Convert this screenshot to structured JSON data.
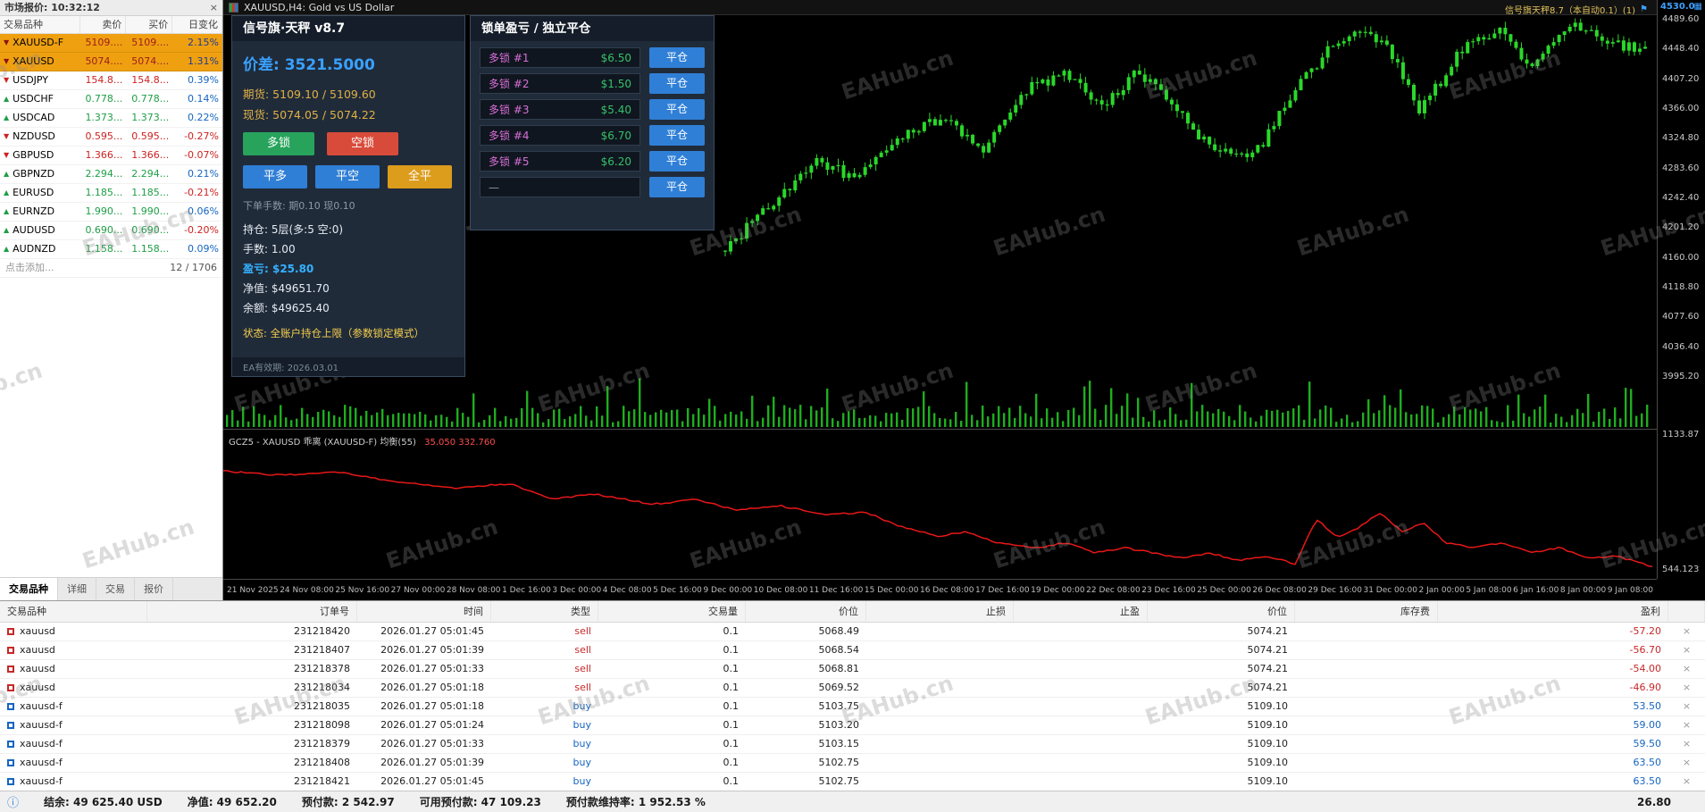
{
  "market_watch": {
    "title": "市场报价: 10:32:12",
    "close_glyph": "×",
    "columns": [
      "交易品种",
      "卖价",
      "买价",
      "日变化"
    ],
    "rows": [
      {
        "sym": "XAUUSD-F",
        "bid": "5109....",
        "ask": "5109....",
        "chg": "2.15%",
        "tick": "down",
        "price_color": "#9b1c1c",
        "chg_color": "#1f3a93",
        "hl": true
      },
      {
        "sym": "XAUUSD",
        "bid": "5074....",
        "ask": "5074....",
        "chg": "1.31%",
        "tick": "down",
        "price_color": "#9b1c1c",
        "chg_color": "#1f3a93",
        "hl": true
      },
      {
        "sym": "USDJPY",
        "bid": "154.8...",
        "ask": "154.8...",
        "chg": "0.39%",
        "tick": "down",
        "price_color": "#cc2222",
        "chg_color": "#1565c0",
        "hl": false
      },
      {
        "sym": "USDCHF",
        "bid": "0.778...",
        "ask": "0.778...",
        "chg": "0.14%",
        "tick": "up",
        "price_color": "#1e9e46",
        "chg_color": "#1565c0",
        "hl": false
      },
      {
        "sym": "USDCAD",
        "bid": "1.373...",
        "ask": "1.373...",
        "chg": "0.22%",
        "tick": "up",
        "price_color": "#1e9e46",
        "chg_color": "#1565c0",
        "hl": false
      },
      {
        "sym": "NZDUSD",
        "bid": "0.595...",
        "ask": "0.595...",
        "chg": "-0.27%",
        "tick": "down",
        "price_color": "#cc2222",
        "chg_color": "#cc2222",
        "hl": false
      },
      {
        "sym": "GBPUSD",
        "bid": "1.366...",
        "ask": "1.366...",
        "chg": "-0.07%",
        "tick": "down",
        "price_color": "#cc2222",
        "chg_color": "#cc2222",
        "hl": false
      },
      {
        "sym": "GBPNZD",
        "bid": "2.294...",
        "ask": "2.294...",
        "chg": "0.21%",
        "tick": "up",
        "price_color": "#1e9e46",
        "chg_color": "#1565c0",
        "hl": false
      },
      {
        "sym": "EURUSD",
        "bid": "1.185...",
        "ask": "1.185...",
        "chg": "-0.21%",
        "tick": "up",
        "price_color": "#1e9e46",
        "chg_color": "#cc2222",
        "hl": false
      },
      {
        "sym": "EURNZD",
        "bid": "1.990...",
        "ask": "1.990...",
        "chg": "0.06%",
        "tick": "up",
        "price_color": "#1e9e46",
        "chg_color": "#1565c0",
        "hl": false
      },
      {
        "sym": "AUDUSD",
        "bid": "0.690...",
        "ask": "0.690...",
        "chg": "-0.20%",
        "tick": "up",
        "price_color": "#1e9e46",
        "chg_color": "#cc2222",
        "hl": false
      },
      {
        "sym": "AUDNZD",
        "bid": "1.158...",
        "ask": "1.158...",
        "chg": "0.09%",
        "tick": "up",
        "price_color": "#1e9e46",
        "chg_color": "#1565c0",
        "hl": false
      }
    ],
    "footer_left": "点击添加...",
    "footer_right": "12 / 1706",
    "tabs": [
      "交易品种",
      "详细",
      "交易",
      "报价"
    ],
    "active_tab": 0
  },
  "chart": {
    "title": "XAUUSD,H4: Gold vs US Dollar",
    "overlay_label": "信号旗天秤8.7（本自动0.1）(1)",
    "corner_icon": "▦"
  },
  "ea_panel": {
    "title": "信号旗·天秤 v8.7",
    "spread_line": "价差: 3521.5000",
    "futures_line": "期货: 5109.10 / 5109.60",
    "spot_line": "现货: 5074.05 / 5074.22",
    "btn_long_lock": "多锁",
    "btn_short_lock": "空锁",
    "btn_close_long": "平多",
    "btn_close_short": "平空",
    "btn_close_all": "全平",
    "lots_line": "下单手数: 期0.10 现0.10",
    "pos_line": "持仓: 5层(多:5 空:0)",
    "hand_line": "手数: 1.00",
    "pl_line": "盈亏: $25.80",
    "equity_line": "净值: $49651.70",
    "balance_line": "余额: $49625.40",
    "status_line": "状态: 全账户持仓上限（参数锁定模式）",
    "expiry_line": "EA有效期: 2026.03.01"
  },
  "lock_panel": {
    "title": "锁单盈亏 / 独立平仓",
    "close_label": "平仓",
    "rows": [
      {
        "label": "多锁 #1",
        "value": "$6.50"
      },
      {
        "label": "多锁 #2",
        "value": "$1.50"
      },
      {
        "label": "多锁 #3",
        "value": "$5.40"
      },
      {
        "label": "多锁 #4",
        "value": "$6.70"
      },
      {
        "label": "多锁 #5",
        "value": "$6.20"
      },
      {
        "label": "—",
        "value": ""
      }
    ]
  },
  "toolbox": {
    "columns": [
      "交易品种",
      "订单号",
      "时间",
      "类型",
      "交易量",
      "价位",
      "止损",
      "止盈",
      "价位",
      "库存费",
      "盈利"
    ],
    "rows": [
      {
        "symbol": "xauusd",
        "order": "231218420",
        "time": "2026.01.27 05:01:45",
        "type": "sell",
        "volume": "0.1",
        "price": "5068.49",
        "sl": "",
        "tp": "",
        "price2": "5074.21",
        "swap": "",
        "profit": "-57.20"
      },
      {
        "symbol": "xauusd",
        "order": "231218407",
        "time": "2026.01.27 05:01:39",
        "type": "sell",
        "volume": "0.1",
        "price": "5068.54",
        "sl": "",
        "tp": "",
        "price2": "5074.21",
        "swap": "",
        "profit": "-56.70"
      },
      {
        "symbol": "xauusd",
        "order": "231218378",
        "time": "2026.01.27 05:01:33",
        "type": "sell",
        "volume": "0.1",
        "price": "5068.81",
        "sl": "",
        "tp": "",
        "price2": "5074.21",
        "swap": "",
        "profit": "-54.00"
      },
      {
        "symbol": "xauusd",
        "order": "231218034",
        "time": "2026.01.27 05:01:18",
        "type": "sell",
        "volume": "0.1",
        "price": "5069.52",
        "sl": "",
        "tp": "",
        "price2": "5074.21",
        "swap": "",
        "profit": "-46.90"
      },
      {
        "symbol": "xauusd-f",
        "order": "231218035",
        "time": "2026.01.27 05:01:18",
        "type": "buy",
        "volume": "0.1",
        "price": "5103.75",
        "sl": "",
        "tp": "",
        "price2": "5109.10",
        "swap": "",
        "profit": "53.50"
      },
      {
        "symbol": "xauusd-f",
        "order": "231218098",
        "time": "2026.01.27 05:01:24",
        "type": "buy",
        "volume": "0.1",
        "price": "5103.20",
        "sl": "",
        "tp": "",
        "price2": "5109.10",
        "swap": "",
        "profit": "59.00"
      },
      {
        "symbol": "xauusd-f",
        "order": "231218379",
        "time": "2026.01.27 05:01:33",
        "type": "buy",
        "volume": "0.1",
        "price": "5103.15",
        "sl": "",
        "tp": "",
        "price2": "5109.10",
        "swap": "",
        "profit": "59.50"
      },
      {
        "symbol": "xauusd-f",
        "order": "231218408",
        "time": "2026.01.27 05:01:39",
        "type": "buy",
        "volume": "0.1",
        "price": "5102.75",
        "sl": "",
        "tp": "",
        "price2": "5109.10",
        "swap": "",
        "profit": "63.50"
      },
      {
        "symbol": "xauusd-f",
        "order": "231218421",
        "time": "2026.01.27 05:01:45",
        "type": "buy",
        "volume": "0.1",
        "price": "5102.75",
        "sl": "",
        "tp": "",
        "price2": "5109.10",
        "swap": "",
        "profit": "63.50"
      }
    ],
    "close_glyph": "×"
  },
  "status_bar": {
    "icon": "ⓘ",
    "items": [
      "结余: 49 625.40 USD",
      "净值: 49 652.20",
      "预付款: 2 542.97",
      "可用预付款: 47 109.23",
      "预付款维持率: 1 952.53 %"
    ],
    "total_profit": "26.80"
  },
  "watermark": "EAHub.cn",
  "chart_data": {
    "type": "candlestick",
    "symbol": "XAUUSD",
    "timeframe": "H4",
    "main": {
      "price_axis": [
        "4489.60",
        "4448.40",
        "4407.20",
        "4366.00",
        "4324.80",
        "4283.60",
        "4242.40",
        "4201.20",
        "4160.00",
        "4118.80",
        "4077.60",
        "4036.40",
        "3995.20"
      ],
      "top_marker": "4530.0",
      "trend_anchors": [
        [
          0,
          4170
        ],
        [
          0.05,
          4235
        ],
        [
          0.1,
          4298
        ],
        [
          0.14,
          4268
        ],
        [
          0.19,
          4330
        ],
        [
          0.24,
          4352
        ],
        [
          0.28,
          4310
        ],
        [
          0.33,
          4398
        ],
        [
          0.37,
          4412
        ],
        [
          0.41,
          4368
        ],
        [
          0.45,
          4420
        ],
        [
          0.49,
          4362
        ],
        [
          0.53,
          4312
        ],
        [
          0.575,
          4300
        ],
        [
          0.61,
          4378
        ],
        [
          0.655,
          4445
        ],
        [
          0.695,
          4480
        ],
        [
          0.72,
          4452
        ],
        [
          0.755,
          4360
        ],
        [
          0.8,
          4448
        ],
        [
          0.845,
          4478
        ],
        [
          0.875,
          4425
        ],
        [
          0.925,
          4485
        ],
        [
          0.965,
          4458
        ],
        [
          1,
          4446
        ]
      ]
    },
    "indicator": {
      "name": "GCZ5 - XAUUSD 乖离 (XAUUSD-F) 均衡(55)",
      "values": "35.050 332.760",
      "axis_labels": [
        "1133.87",
        "544.123"
      ],
      "line_anchors": [
        [
          0,
          980
        ],
        [
          0.04,
          962
        ],
        [
          0.08,
          975
        ],
        [
          0.12,
          935
        ],
        [
          0.16,
          905
        ],
        [
          0.2,
          925
        ],
        [
          0.23,
          860
        ],
        [
          0.26,
          880
        ],
        [
          0.3,
          835
        ],
        [
          0.33,
          855
        ],
        [
          0.36,
          810
        ],
        [
          0.39,
          828
        ],
        [
          0.42,
          790
        ],
        [
          0.45,
          800
        ],
        [
          0.47,
          745
        ],
        [
          0.5,
          695
        ],
        [
          0.52,
          715
        ],
        [
          0.54,
          668
        ],
        [
          0.57,
          645
        ],
        [
          0.59,
          668
        ],
        [
          0.61,
          622
        ],
        [
          0.63,
          645
        ],
        [
          0.655,
          618
        ],
        [
          0.67,
          600
        ],
        [
          0.69,
          622
        ],
        [
          0.71,
          590
        ],
        [
          0.73,
          608
        ],
        [
          0.75,
          575
        ],
        [
          0.765,
          770
        ],
        [
          0.78,
          690
        ],
        [
          0.795,
          735
        ],
        [
          0.81,
          800
        ],
        [
          0.825,
          712
        ],
        [
          0.84,
          756
        ],
        [
          0.855,
          668
        ],
        [
          0.875,
          645
        ],
        [
          0.895,
          668
        ],
        [
          0.915,
          622
        ],
        [
          0.935,
          645
        ],
        [
          0.955,
          600
        ],
        [
          0.975,
          608
        ],
        [
          1,
          562
        ]
      ]
    },
    "time_axis": [
      "21 Nov 2025",
      "24 Nov 08:00",
      "25 Nov 16:00",
      "27 Nov 00:00",
      "28 Nov 08:00",
      "1 Dec 16:00",
      "3 Dec 00:00",
      "4 Dec 08:00",
      "5 Dec 16:00",
      "9 Dec 00:00",
      "10 Dec 08:00",
      "11 Dec 16:00",
      "15 Dec 00:00",
      "16 Dec 08:00",
      "17 Dec 16:00",
      "19 Dec 00:00",
      "22 Dec 08:00",
      "23 Dec 16:00",
      "25 Dec 00:00",
      "26 Dec 08:00",
      "29 Dec 16:00",
      "31 Dec 00:00",
      "2 Jan 00:00",
      "5 Jan 08:00",
      "6 Jan 16:00",
      "8 Jan 00:00",
      "9 Jan 08:00"
    ]
  }
}
